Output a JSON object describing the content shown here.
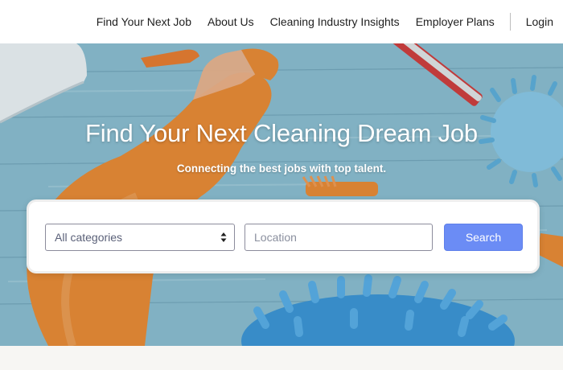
{
  "nav": {
    "items": [
      {
        "label": "Find Your Next Job"
      },
      {
        "label": "About Us"
      },
      {
        "label": "Cleaning Industry Insights"
      },
      {
        "label": "Employer Plans"
      }
    ],
    "login_label": "Login"
  },
  "hero": {
    "title": "Find Your Next Cleaning Dream Job",
    "subtitle": "Connecting the best jobs with top talent."
  },
  "search": {
    "category_value": "All categories",
    "location_placeholder": "Location",
    "location_value": "",
    "button_label": "Search"
  },
  "colors": {
    "accent_button": "#6b8cf5",
    "hero_wood": "#7fb6ca",
    "bottle_orange": "#f28a2e",
    "mop_blue": "#4aa3e0"
  },
  "icons": {
    "select_arrows": "sort-arrows-icon"
  }
}
